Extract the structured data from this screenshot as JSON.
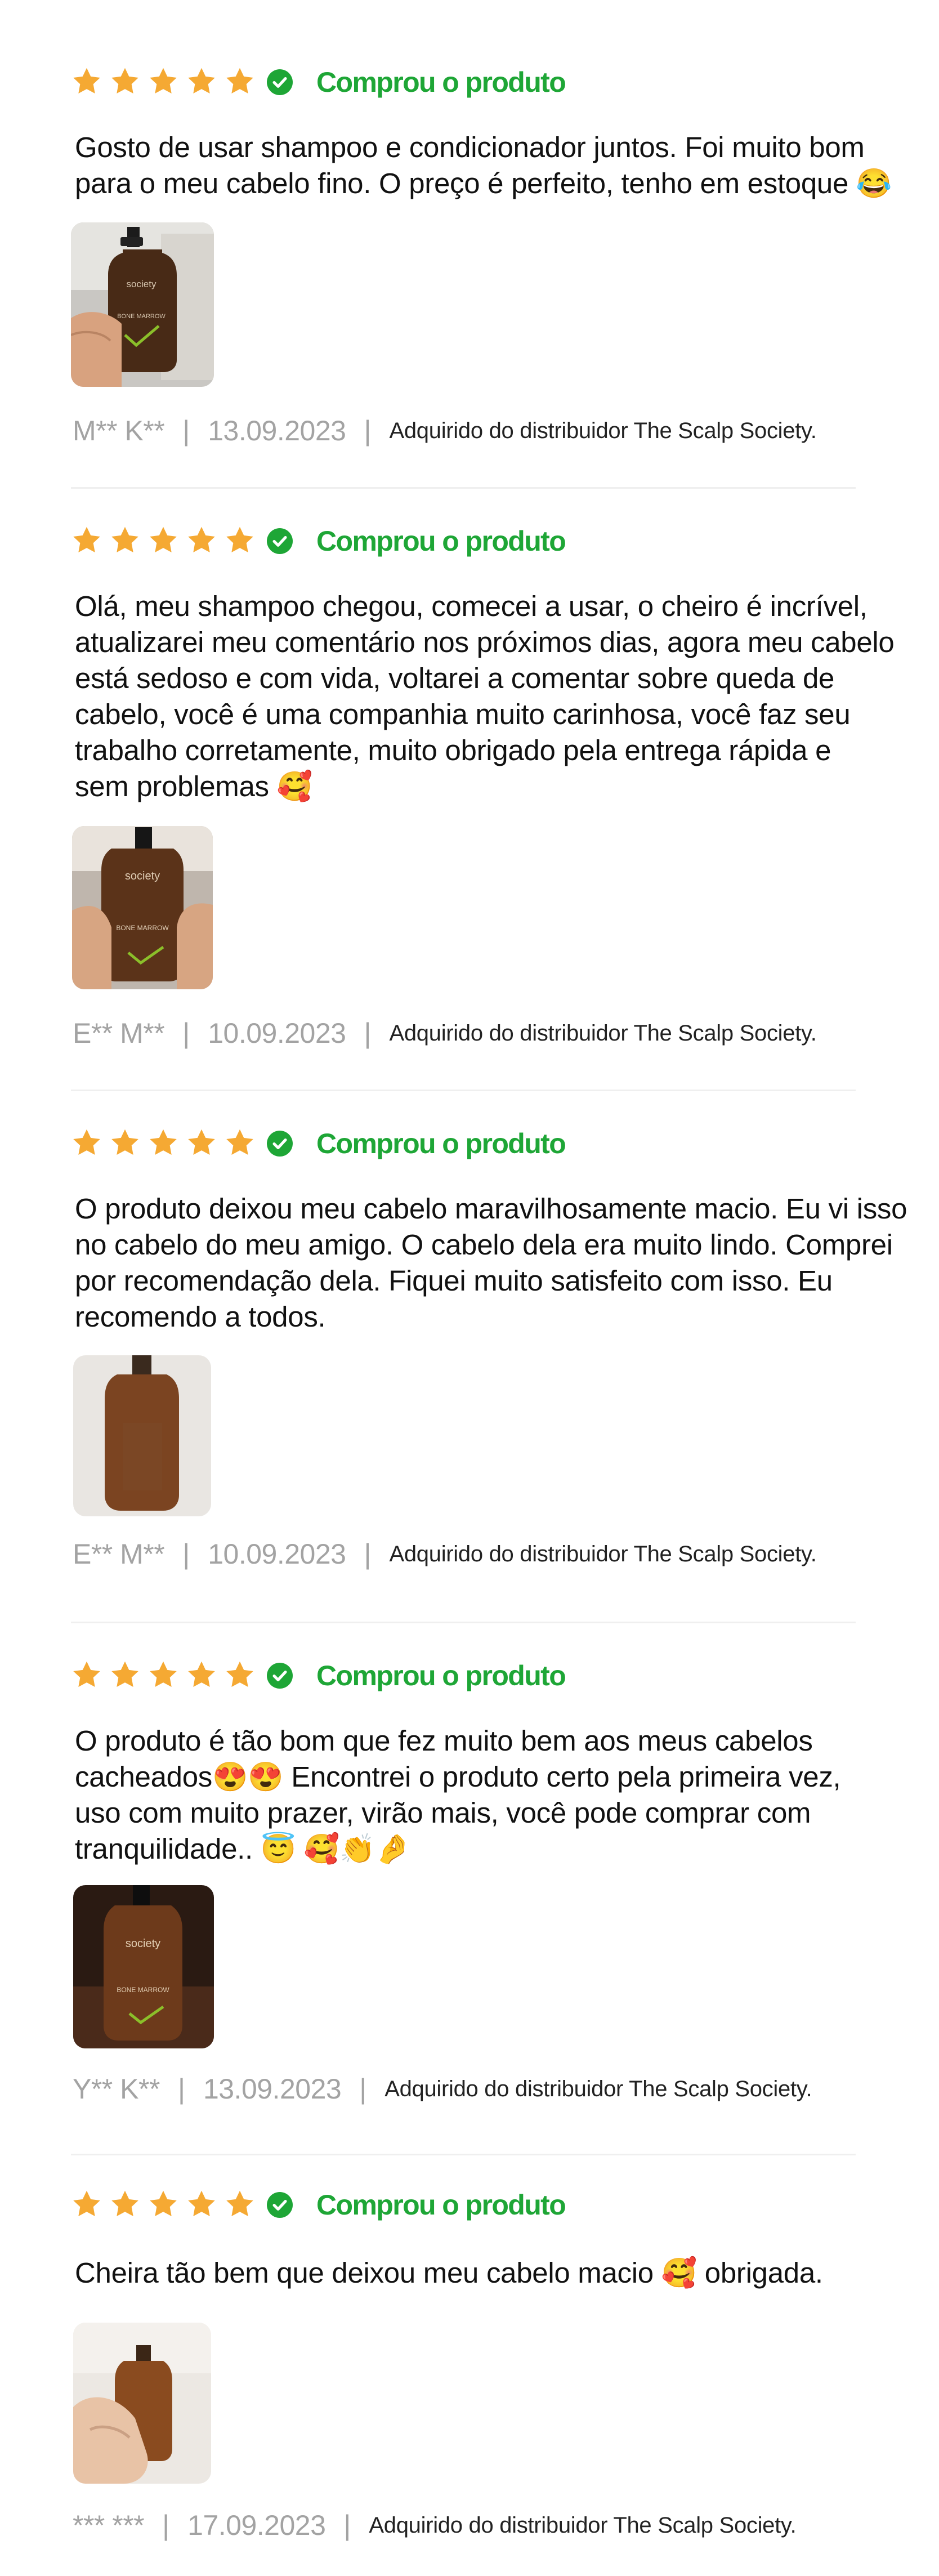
{
  "colors": {
    "star": "#f5a933",
    "verified": "#1ea636",
    "meta": "#a3a3a3",
    "text": "#111111"
  },
  "reviews": [
    {
      "rating": 5,
      "verified_label": "Comprou o produto",
      "text_lines": [
        "Gosto de usar shampoo e condicionador juntos. Foi muito bom",
        "para o meu cabelo fino. O preço é perfeito, tenho em estoque 😂"
      ],
      "author": "M** K**",
      "date": "13.09.2023",
      "source": "Adquirido do distribuidor The Scalp Society."
    },
    {
      "rating": 5,
      "verified_label": "Comprou o produto",
      "text_lines": [
        "Olá, meu shampoo chegou, comecei a usar, o cheiro é incrível,",
        "atualizarei meu comentário nos próximos dias, agora meu cabelo",
        "está sedoso e com vida, voltarei a comentar sobre queda de",
        "cabelo, você é uma companhia muito carinhosa, você faz seu",
        "trabalho corretamente, muito obrigado pela entrega rápida e",
        "sem problemas 🥰"
      ],
      "author": "E** M**",
      "date": "10.09.2023",
      "source": "Adquirido do distribuidor The Scalp Society."
    },
    {
      "rating": 5,
      "verified_label": "Comprou o produto",
      "text_lines": [
        "O produto deixou meu cabelo maravilhosamente macio. Eu vi isso",
        "no cabelo do meu amigo. O cabelo dela era muito lindo. Comprei",
        "por recomendação dela. Fiquei muito satisfeito com isso. Eu",
        "recomendo a todos."
      ],
      "author": "E** M**",
      "date": "10.09.2023",
      "source": "Adquirido do distribuidor The Scalp Society."
    },
    {
      "rating": 5,
      "verified_label": "Comprou o produto",
      "text_lines": [
        "O produto é tão bom que fez muito bem aos meus cabelos",
        "cacheados😍😍 Encontrei o produto certo pela primeira vez,",
        "uso com muito prazer, virão mais, você pode comprar com",
        "tranquilidade.. 😇 🥰👏🤌"
      ],
      "author": "Y** K**",
      "date": "13.09.2023",
      "source": "Adquirido do distribuidor The Scalp Society."
    },
    {
      "rating": 5,
      "verified_label": "Comprou o produto",
      "text_lines": [
        "Cheira tão bem que deixou meu cabelo macio 🥰 obrigada."
      ],
      "author": "*** ***",
      "date": "17.09.2023",
      "source": "Adquirido do distribuidor The Scalp Society."
    }
  ],
  "photo_labels": {
    "brand": "society",
    "product": "BONE MARROW"
  }
}
